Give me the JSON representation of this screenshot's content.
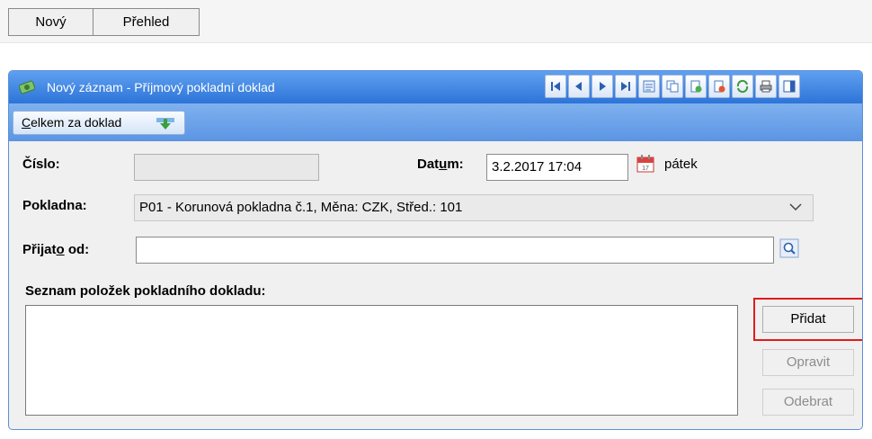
{
  "tabs": {
    "new": "Nový",
    "overview": "Přehled"
  },
  "panel": {
    "title": "Nový záznam - Příjmový pokladní doklad",
    "total_btn": {
      "underlined": "C",
      "rest": "elkem za doklad"
    }
  },
  "form": {
    "cislo_label": "Číslo:",
    "cislo_value": "",
    "datum_label": {
      "pre": "Dat",
      "u": "u",
      "post": "m:"
    },
    "datum_value": "3.2.2017 17:04",
    "day_name": "pátek",
    "pokladna_label": "Pokladna:",
    "pokladna_value": "P01 - Korunová pokladna č.1, Měna: CZK, Střed.: 101",
    "prijato_label": {
      "pre": "Přijat",
      "u": "o",
      "post": " od:"
    },
    "prijato_value": "",
    "items_label": "Seznam položek pokladního dokladu:"
  },
  "buttons": {
    "add": "Přidat",
    "edit": "Opravit",
    "remove": "Odebrat"
  },
  "icons": {
    "nav": [
      "first-icon",
      "prev-icon",
      "next-icon",
      "last-icon",
      "list-icon",
      "copy-icon",
      "new-doc-icon",
      "delete-doc-icon",
      "refresh-icon",
      "print-icon",
      "window-icon"
    ]
  },
  "colors": {
    "title_bar": "#2d74d8",
    "highlight": "#e11b1b"
  }
}
